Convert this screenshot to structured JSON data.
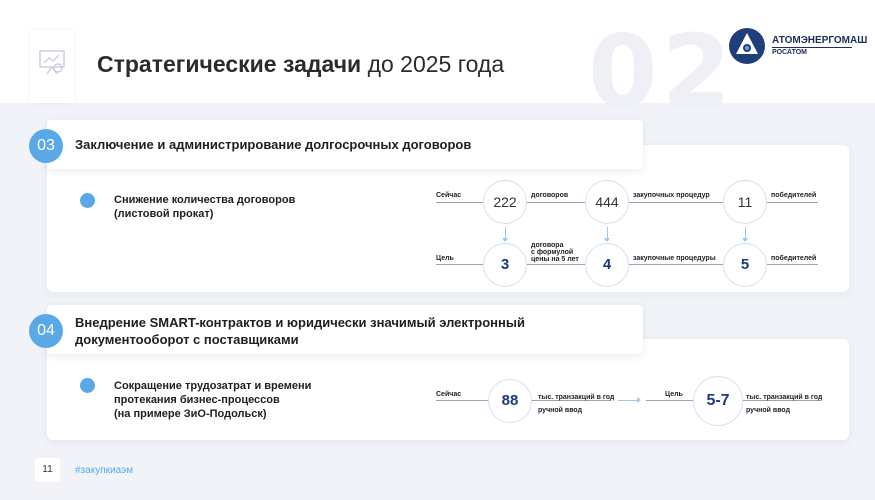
{
  "header": {
    "title_bold": "Стратегические задачи",
    "title_rest": " до 2025 года",
    "big_number": "02",
    "icon": "presentation-chart-icon"
  },
  "logo": {
    "line1": "АТОМЭНЕРГОМАШ",
    "line2": "РОСАТОМ",
    "icon": "rosatom-logo-mark"
  },
  "sections": [
    {
      "number": "03",
      "title": "Заключение и администрирование долгосрочных договоров",
      "task_lines": [
        "Снижение количества договоров",
        "(листовой прокат)"
      ],
      "row_labels": {
        "now": "Сейчас",
        "goal": "Цель"
      },
      "metrics": [
        {
          "current": "222",
          "current_unit": "договоров",
          "target": "3",
          "target_unit_lines": [
            "договора",
            "с формулой",
            "цены на 5 лет"
          ]
        },
        {
          "current": "444",
          "current_unit": "закупочных процедур",
          "target": "4",
          "target_unit": "закупочные процедуры"
        },
        {
          "current": "11",
          "current_unit": "победителей",
          "target": "5",
          "target_unit": "победителей"
        }
      ]
    },
    {
      "number": "04",
      "title_lines": [
        "Внедрение SMART-контрактов и юридически значимый электронный",
        "документооборот с поставщиками"
      ],
      "task_lines": [
        "Сокращение трудозатрат и времени",
        "протекания бизнес-процессов",
        "(на примере ЗиО-Подольск)"
      ],
      "now_label": "Сейчас",
      "goal_label": "Цель",
      "current": "88",
      "current_unit_lines": [
        "тыс. транзакций в год",
        "ручной ввод"
      ],
      "target": "5-7",
      "target_unit_lines": [
        "тыс. транзакций в год",
        "ручной ввод"
      ]
    }
  ],
  "footer": {
    "page": "11",
    "hashtag": "#закупкиаэм"
  },
  "colors": {
    "accent": "#5aa9e6",
    "navy": "#1a3a7a",
    "background": "#f1f3f9"
  }
}
